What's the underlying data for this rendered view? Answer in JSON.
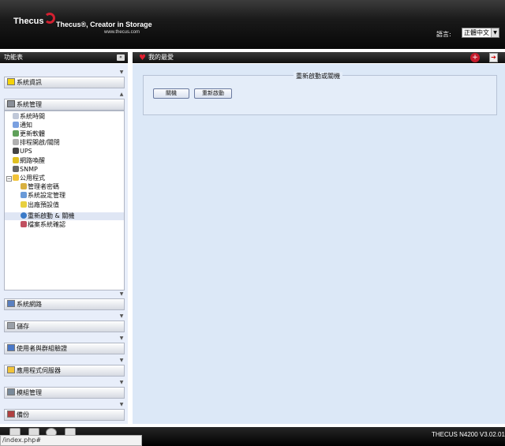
{
  "header": {
    "logo": "Thecus",
    "tagline": "Thecus®, Creator in Storage",
    "url": "www.thecus.com",
    "language_label": "語言:",
    "language_value": "正體中文"
  },
  "sidebar": {
    "title": "功能表",
    "collapse_icon": "double-chevron-left-icon",
    "sections": [
      {
        "label": "系統資訊",
        "icon": "info-icon"
      },
      {
        "label": "系統管理",
        "icon": "tools-icon"
      },
      {
        "label": "系統網路",
        "icon": "network-icon"
      },
      {
        "label": "儲存",
        "icon": "storage-icon"
      },
      {
        "label": "使用者與群組驗證",
        "icon": "users-icon"
      },
      {
        "label": "應用程式伺服器",
        "icon": "folder-icon"
      },
      {
        "label": "模組管理",
        "icon": "module-icon"
      },
      {
        "label": "備份",
        "icon": "backup-icon"
      }
    ],
    "tree_items": [
      {
        "label": "系統時間",
        "icon": "clock-icon"
      },
      {
        "label": "通知",
        "icon": "notify-icon"
      },
      {
        "label": "更新軟體",
        "icon": "update-icon"
      },
      {
        "label": "排程開啟/關閉",
        "icon": "schedule-icon"
      },
      {
        "label": "UPS",
        "icon": "ups-icon"
      },
      {
        "label": "網路喚醒",
        "icon": "wake-icon"
      },
      {
        "label": "SNMP",
        "icon": "snmp-icon"
      },
      {
        "label": "公用程式",
        "icon": "folder-icon"
      },
      {
        "label": "管理者密碼",
        "icon": "key-icon"
      },
      {
        "label": "系統設定管理",
        "icon": "config-icon"
      },
      {
        "label": "出廠預設值",
        "icon": "reset-icon"
      },
      {
        "label": "重新啟動 & 關機",
        "icon": "power-icon"
      },
      {
        "label": "檔案系統確認",
        "icon": "filecheck-icon"
      }
    ]
  },
  "main": {
    "title": "我的最愛",
    "section_title": "重新啟動或關機",
    "shutdown_label": "關機",
    "reboot_label": "重新啟動"
  },
  "footer": {
    "version": "THECUS N4200 V3.02.01",
    "status_url": "/index.php#"
  },
  "colors": {
    "accent": "#d32030",
    "panel_bg": "#dce8f7"
  }
}
